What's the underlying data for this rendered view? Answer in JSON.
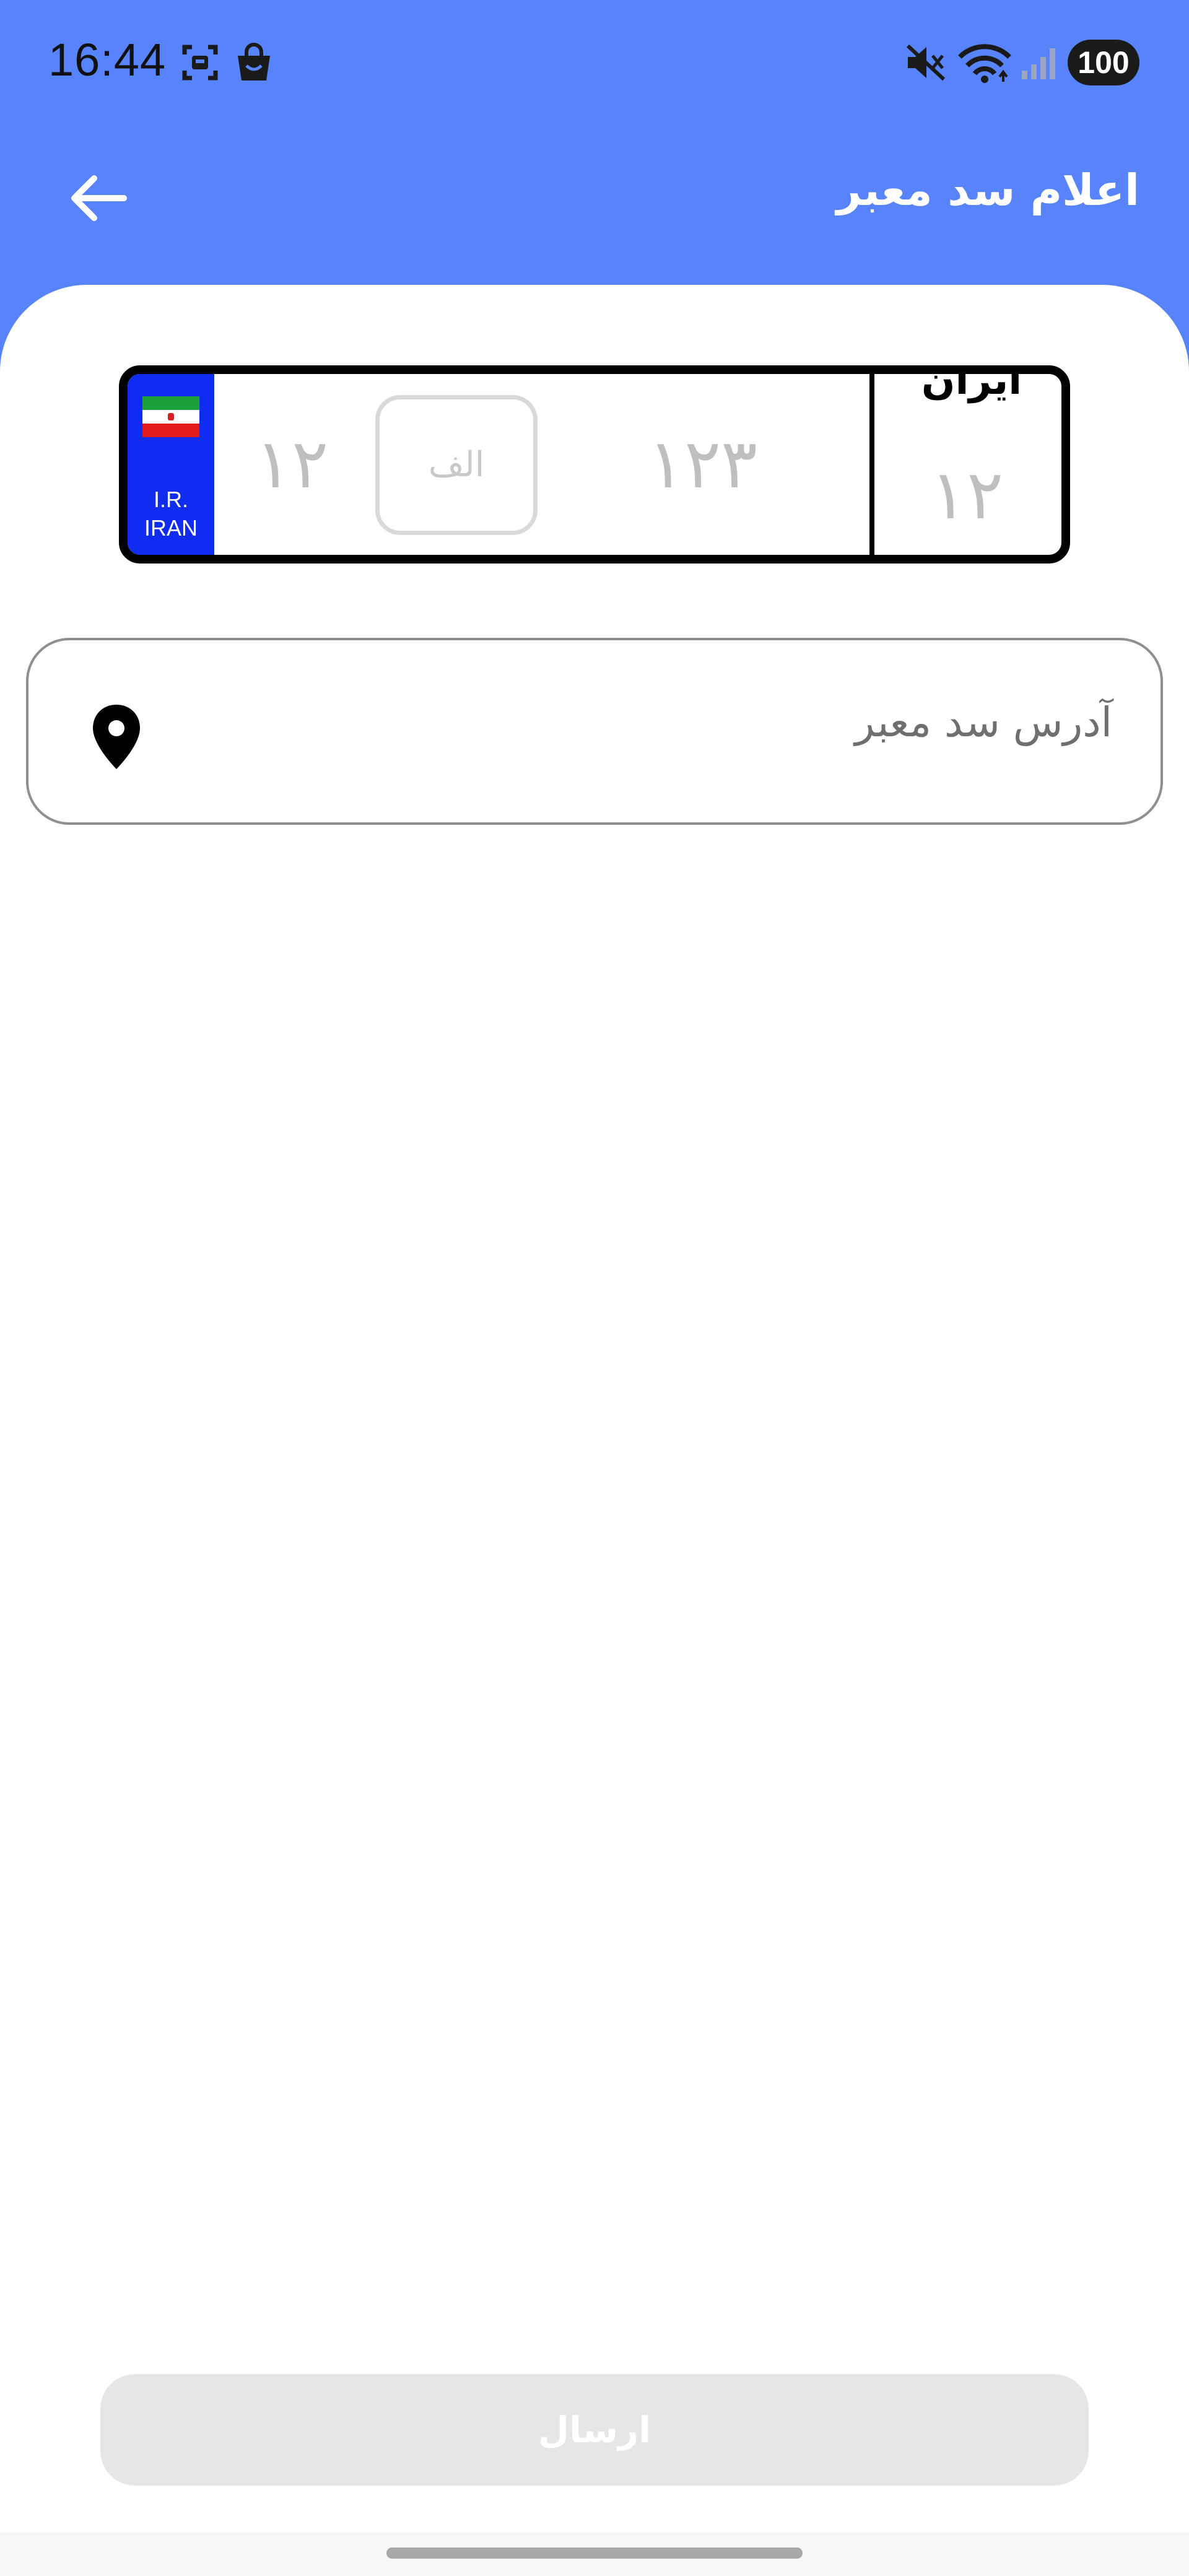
{
  "status_bar": {
    "time": "16:44",
    "battery": "100",
    "icons": [
      "screenshot-icon",
      "shopping-bag-icon",
      "mute-icon",
      "wifi-icon",
      "signal-icon"
    ]
  },
  "header": {
    "title": "اعلام سد معبر",
    "back_icon": "arrow-left-icon"
  },
  "plate": {
    "country_code_line1": "I.R.",
    "country_code_line2": "IRAN",
    "left_number": "۱۲",
    "letter": "الف",
    "middle_number": "۱۲۳",
    "country_label": "ایران",
    "region_number": "۱۲"
  },
  "address": {
    "placeholder": "آدرس سد معبر",
    "icon": "location-pin-icon"
  },
  "submit": {
    "label": "ارسال"
  },
  "colors": {
    "header_bg": "#5783fb",
    "plate_blue": "#0f2cf0",
    "button_disabled": "#e6e6e6"
  }
}
